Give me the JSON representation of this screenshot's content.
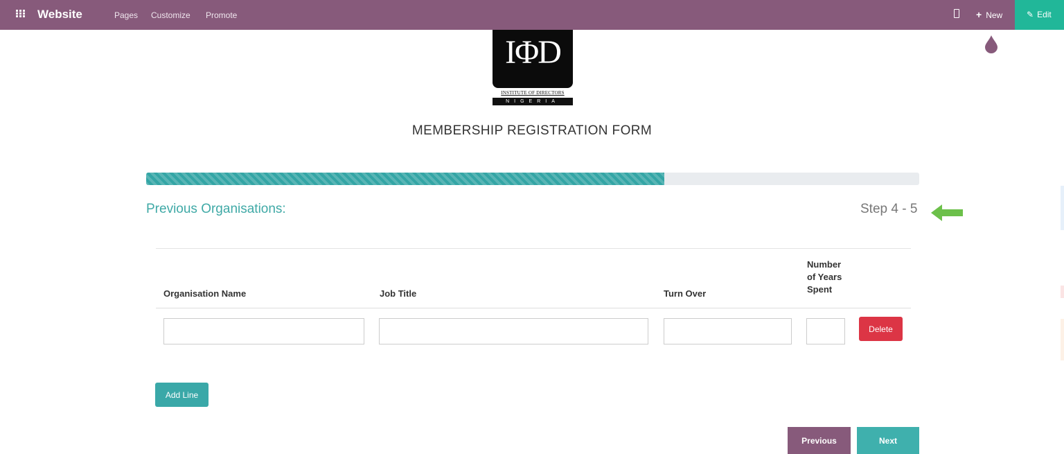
{
  "topbar": {
    "brand": "Website",
    "menu": [
      "Pages",
      "Customize",
      "Promote"
    ],
    "new_label": "New",
    "edit_label": "Edit",
    "background_color": "#875a7b",
    "edit_color": "#21b799"
  },
  "logo": {
    "mark": "IΦD",
    "line1": "INSTITUTE OF DIRECTORS",
    "line2": "NIGERIA"
  },
  "form": {
    "title": "MEMBERSHIP REGISTRATION FORM",
    "progress_fraction": 0.67,
    "section_title": "Previous Organisations:",
    "step": "Step 4 - 5"
  },
  "table": {
    "headers": {
      "organisation": "Organisation Name",
      "job_title": "Job Title",
      "turnover": "Turn Over",
      "years_line1": "Number",
      "years_line2": "of Years",
      "years_line3": "Spent"
    },
    "row": {
      "organisation": "",
      "job_title": "",
      "turnover": "",
      "years": "",
      "delete_label": "Delete"
    }
  },
  "buttons": {
    "add_line": "Add Line",
    "previous": "Previous",
    "next": "Next"
  },
  "colors": {
    "accent": "#3fa9a6",
    "delete": "#dc3545",
    "previous": "#875a7b",
    "arrow": "#6cc04a"
  },
  "icons": [
    "apps-grid-icon",
    "mobile-preview-icon",
    "plus-icon",
    "pencil-icon",
    "droplet-icon",
    "arrow-left-icon"
  ]
}
